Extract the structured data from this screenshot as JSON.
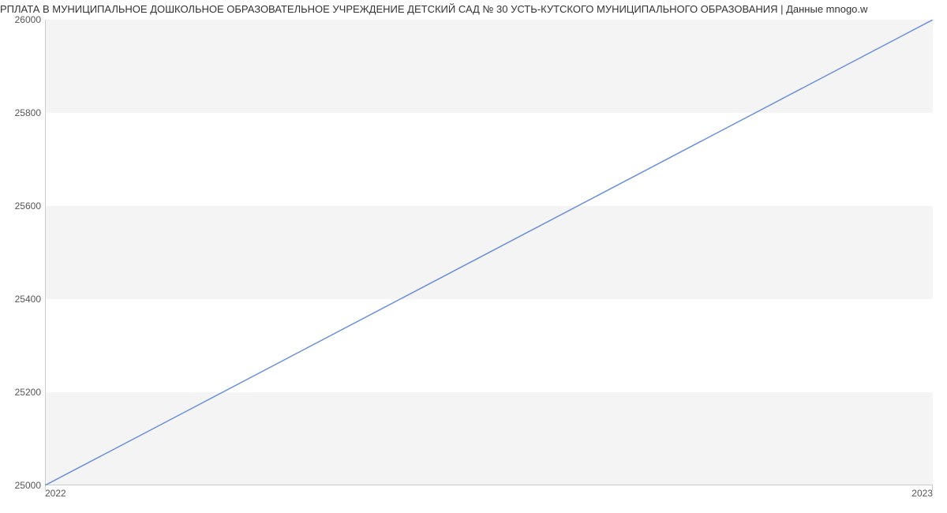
{
  "chart_data": {
    "type": "line",
    "title": "РПЛАТА В МУНИЦИПАЛЬНОЕ ДОШКОЛЬНОЕ ОБРАЗОВАТЕЛЬНОЕ УЧРЕЖДЕНИЕ ДЕТСКИЙ САД № 30 УСТЬ-КУТСКОГО МУНИЦИПАЛЬНОГО ОБРАЗОВАНИЯ | Данные mnogo.w",
    "x": [
      2022,
      2023
    ],
    "values": [
      25000,
      26000
    ],
    "xlabel": "",
    "ylabel": "",
    "ylim": [
      25000,
      26000
    ],
    "xlim": [
      2022,
      2023
    ],
    "y_ticks": [
      25000,
      25200,
      25400,
      25600,
      25800,
      26000
    ],
    "x_ticks": [
      2022,
      2023
    ],
    "y_tick_labels": [
      "25000",
      "25200",
      "25400",
      "25600",
      "25800",
      "26000"
    ],
    "x_tick_labels": [
      "2022",
      "2023"
    ]
  }
}
